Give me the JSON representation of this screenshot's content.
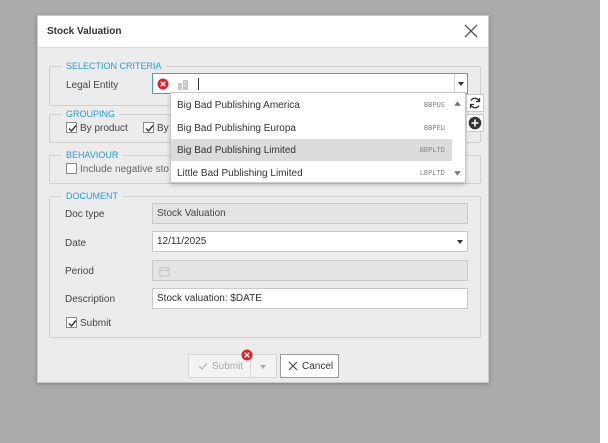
{
  "dialog": {
    "title": "Stock Valuation"
  },
  "selection": {
    "legend": "SELECTION CRITERIA",
    "legal_entity_label": "Legal Entity",
    "legal_entity_value": ""
  },
  "dropdown": {
    "items": [
      {
        "name": "Big Bad Publishing America",
        "code": "BBPUS",
        "selected": false
      },
      {
        "name": "Big Bad Publishing Europa",
        "code": "BBPEU",
        "selected": false
      },
      {
        "name": "Big Bad Publishing Limited",
        "code": "BBPLTD",
        "selected": true
      },
      {
        "name": "Little Bad Publishing Limited",
        "code": "LBPLTD",
        "selected": false
      }
    ]
  },
  "grouping": {
    "legend": "GROUPING",
    "by_product_label": "By product",
    "by_product_checked": true,
    "second_label": "By",
    "second_checked": true
  },
  "behaviour": {
    "legend": "BEHAVIOUR",
    "include_negative_label": "Include negative sto",
    "include_negative_checked": false
  },
  "document": {
    "legend": "DOCUMENT",
    "doc_type_label": "Doc type",
    "doc_type_value": "Stock Valuation",
    "date_label": "Date",
    "date_value": "12/11/2025",
    "period_label": "Period",
    "period_value": "",
    "description_label": "Description",
    "description_value": "Stock valuation: $DATE",
    "submit_label": "Submit",
    "submit_checked": true
  },
  "footer": {
    "submit_button": "Submit",
    "cancel_button": "Cancel"
  },
  "colors": {
    "accent": "#2b9ad8",
    "error": "#e0202c",
    "overlay": "#ababab"
  }
}
